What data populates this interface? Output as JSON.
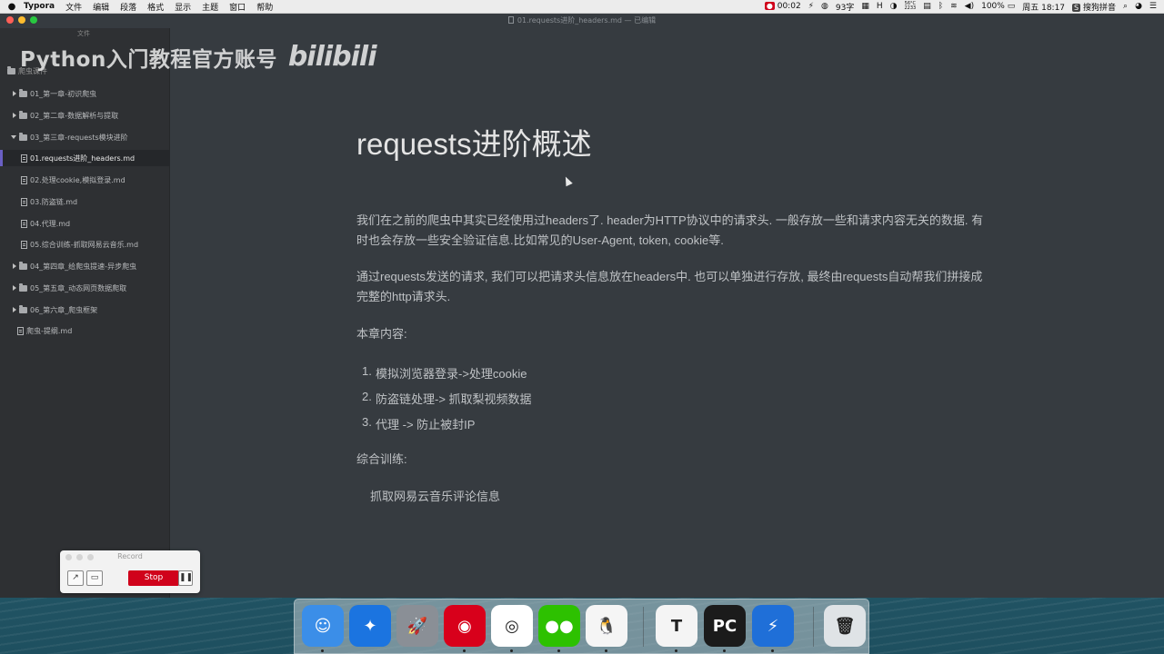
{
  "menubar": {
    "app_name": "Typora",
    "menus": [
      "文件",
      "编辑",
      "段落",
      "格式",
      "显示",
      "主题",
      "窗口",
      "帮助"
    ],
    "status": {
      "recording_time": "00:02",
      "word_count": "93字",
      "temperature_top": "56°C",
      "temperature_bottom": "2233",
      "battery": "100%",
      "clock": "周五 18:17",
      "ime": "搜狗拼音"
    }
  },
  "window": {
    "title": "01.requests进阶_headers.md — 已编辑"
  },
  "watermark": {
    "text": "Python入门教程官方账号",
    "logo": "bilibili"
  },
  "sidebar": {
    "header": "文件",
    "root_label": "爬虫课件",
    "items": [
      {
        "label": "01_第一章-初识爬虫",
        "type": "folder",
        "state": "closed"
      },
      {
        "label": "02_第二章-数据解析与提取",
        "type": "folder",
        "state": "closed"
      },
      {
        "label": "03_第三章-requests模块进阶",
        "type": "folder",
        "state": "open"
      },
      {
        "label": "01.requests进阶_headers.md",
        "type": "file",
        "active": true
      },
      {
        "label": "02.处理cookie,模拟登录.md",
        "type": "file"
      },
      {
        "label": "03.防盗链.md",
        "type": "file"
      },
      {
        "label": "04.代理.md",
        "type": "file"
      },
      {
        "label": "05.综合训练-抓取网易云音乐.md",
        "type": "file"
      },
      {
        "label": "04_第四章_给爬虫提速-异步爬虫",
        "type": "folder",
        "state": "closed"
      },
      {
        "label": "05_第五章_动态网页数据爬取",
        "type": "folder",
        "state": "closed"
      },
      {
        "label": "06_第六章_爬虫框架",
        "type": "folder",
        "state": "closed"
      },
      {
        "label": "爬虫-提纲.md",
        "type": "file"
      }
    ]
  },
  "document": {
    "title": "requests进阶概述",
    "paragraphs": [
      "我们在之前的爬虫中其实已经使用过headers了. header为HTTP协议中的请求头. 一般存放一些和请求内容无关的数据. 有时也会存放一些安全验证信息.比如常见的User-Agent, token, cookie等.",
      "通过requests发送的请求, 我们可以把请求头信息放在headers中. 也可以单独进行存放, 最终由requests自动帮我们拼接成完整的http请求头."
    ],
    "chapter_label": "本章内容:",
    "list": [
      {
        "num": "1.",
        "text": "模拟浏览器登录->处理cookie"
      },
      {
        "num": "2.",
        "text": "防盗链处理-> 抓取梨视频数据"
      },
      {
        "num": "3.",
        "text": "代理 -> 防止被封IP"
      }
    ],
    "training_label": "综合训练:",
    "training_item": "抓取网易云音乐评论信息"
  },
  "record_widget": {
    "title": "Record",
    "stop_label": "Stop",
    "pause_label": "❚❚"
  },
  "dock": {
    "apps": [
      {
        "name": "finder-icon",
        "glyph": "☺",
        "bg": "#3b8ee8",
        "running": true
      },
      {
        "name": "safari-icon",
        "glyph": "✦",
        "bg": "#1b74e0",
        "running": false
      },
      {
        "name": "launchpad-icon",
        "glyph": "🚀",
        "bg": "#8a8f96",
        "running": false
      },
      {
        "name": "netease-music-icon",
        "glyph": "◉",
        "bg": "#d8001b",
        "running": true
      },
      {
        "name": "chrome-icon",
        "glyph": "◎",
        "bg": "#ffffff",
        "running": true
      },
      {
        "name": "wechat-icon",
        "glyph": "●●",
        "bg": "#2dc100",
        "running": true
      },
      {
        "name": "qq-icon",
        "glyph": "🐧",
        "bg": "#f5f5f5",
        "running": true
      },
      {
        "name": "typora-icon",
        "glyph": "T",
        "bg": "#f4f4f4",
        "running": true
      },
      {
        "name": "pycharm-icon",
        "glyph": "PC",
        "bg": "#1b1b1b",
        "running": true
      },
      {
        "name": "thunder-icon",
        "glyph": "⚡",
        "bg": "#1f6fd8",
        "running": true
      },
      {
        "name": "trash-icon",
        "glyph": "🗑",
        "bg": "#dfe3e6",
        "running": false
      }
    ]
  }
}
